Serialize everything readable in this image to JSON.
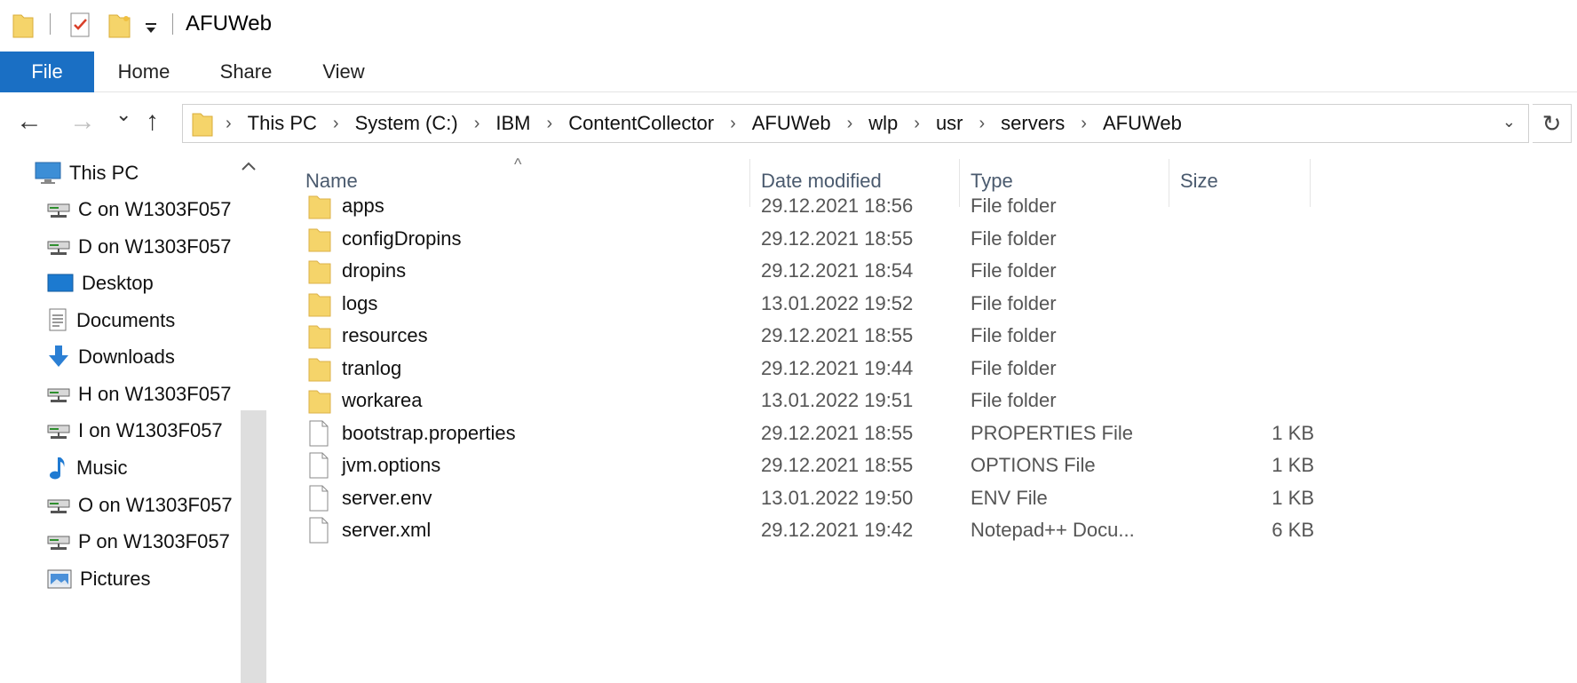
{
  "window": {
    "title": "AFUWeb",
    "quick_access_icons": [
      "folder-icon",
      "properties-checklist-icon",
      "new-folder-icon",
      "customize-toolbar-arrow-icon"
    ]
  },
  "ribbon": {
    "tabs": [
      {
        "label": "File",
        "active": true
      },
      {
        "label": "Home"
      },
      {
        "label": "Share"
      },
      {
        "label": "View"
      }
    ]
  },
  "nav_buttons": {
    "back": "←",
    "forward": "→",
    "recent": "⌄",
    "up": "↑",
    "refresh": "↻",
    "address_dropdown": "⌄"
  },
  "breadcrumbs": [
    "This PC",
    "System (C:)",
    "IBM",
    "ContentCollector",
    "AFUWeb",
    "wlp",
    "usr",
    "servers",
    "AFUWeb"
  ],
  "navpane": {
    "items": [
      {
        "label": "This PC",
        "icon": "this-pc-icon"
      },
      {
        "label": "C on W1303F057",
        "icon": "network-drive-icon"
      },
      {
        "label": "D on W1303F057",
        "icon": "network-drive-icon"
      },
      {
        "label": "Desktop",
        "icon": "desktop-icon"
      },
      {
        "label": "Documents",
        "icon": "documents-icon"
      },
      {
        "label": "Downloads",
        "icon": "downloads-icon"
      },
      {
        "label": "H on W1303F057",
        "icon": "network-drive-icon"
      },
      {
        "label": "I on W1303F057",
        "icon": "network-drive-icon"
      },
      {
        "label": "Music",
        "icon": "music-icon"
      },
      {
        "label": "O on W1303F057",
        "icon": "network-drive-icon"
      },
      {
        "label": "P on W1303F057",
        "icon": "network-drive-icon"
      },
      {
        "label": "Pictures",
        "icon": "pictures-icon"
      }
    ]
  },
  "filelist": {
    "columns": [
      "Name",
      "Date modified",
      "Type",
      "Size"
    ],
    "sort_caret": "^",
    "rows": [
      {
        "name": "apps",
        "date": "29.12.2021 18:56",
        "type": "File folder",
        "size": "",
        "icon": "folder-icon"
      },
      {
        "name": "configDropins",
        "date": "29.12.2021 18:55",
        "type": "File folder",
        "size": "",
        "icon": "folder-icon"
      },
      {
        "name": "dropins",
        "date": "29.12.2021 18:54",
        "type": "File folder",
        "size": "",
        "icon": "folder-icon"
      },
      {
        "name": "logs",
        "date": "13.01.2022 19:52",
        "type": "File folder",
        "size": "",
        "icon": "folder-icon"
      },
      {
        "name": "resources",
        "date": "29.12.2021 18:55",
        "type": "File folder",
        "size": "",
        "icon": "folder-icon"
      },
      {
        "name": "tranlog",
        "date": "29.12.2021 19:44",
        "type": "File folder",
        "size": "",
        "icon": "folder-icon"
      },
      {
        "name": "workarea",
        "date": "13.01.2022 19:51",
        "type": "File folder",
        "size": "",
        "icon": "folder-icon"
      },
      {
        "name": "bootstrap.properties",
        "date": "29.12.2021 18:55",
        "type": "PROPERTIES File",
        "size": "1 KB",
        "icon": "file-icon"
      },
      {
        "name": "jvm.options",
        "date": "29.12.2021 18:55",
        "type": "OPTIONS File",
        "size": "1 KB",
        "icon": "file-icon"
      },
      {
        "name": "server.env",
        "date": "13.01.2022 19:50",
        "type": "ENV File",
        "size": "1 KB",
        "icon": "file-icon"
      },
      {
        "name": "server.xml",
        "date": "29.12.2021 19:42",
        "type": "Notepad++ Docu...",
        "size": "6 KB",
        "icon": "file-icon"
      }
    ]
  },
  "colors": {
    "accent": "#1a6fc4",
    "folder": "#f5d46a",
    "header_text": "#4a5a6e"
  }
}
